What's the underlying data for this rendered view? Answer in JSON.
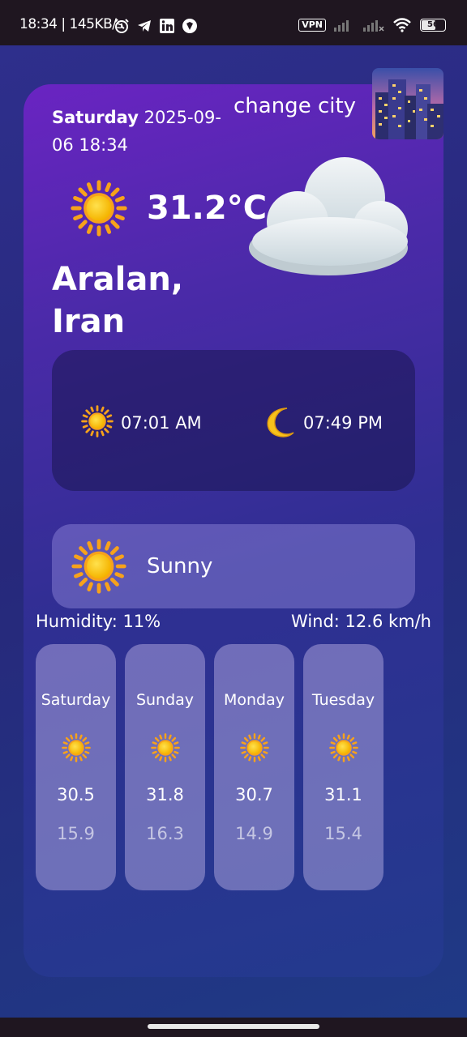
{
  "status_bar": {
    "time_speed": "18:34 | 145KB/s",
    "vpn_label": "VPN",
    "battery_level": "56",
    "icons": [
      "alarm-icon",
      "telegram-icon",
      "linkedin-icon",
      "app-icon",
      "signal-icon",
      "wifi-icon",
      "battery-icon"
    ]
  },
  "header": {
    "day": "Saturday",
    "date_time": "2025-09-06 18:34",
    "change_city_label": "change city"
  },
  "current": {
    "temperature": "31.2°C",
    "location_line1": "Aralan,",
    "location_line2": "Iran",
    "condition": "Sunny",
    "icon": "sun-icon",
    "decor_icon": "cloud-icon"
  },
  "sun_times": {
    "sunrise": "07:01 AM",
    "sunset": "07:49 PM"
  },
  "details": {
    "humidity": "Humidity: 11%",
    "wind": "Wind: 12.6 km/h"
  },
  "forecast": [
    {
      "day": "Saturday",
      "high": "30.5",
      "low": "15.9",
      "icon": "sun-icon"
    },
    {
      "day": "Sunday",
      "high": "31.8",
      "low": "16.3",
      "icon": "sun-icon"
    },
    {
      "day": "Monday",
      "high": "30.7",
      "low": "14.9",
      "icon": "sun-icon"
    },
    {
      "day": "Tuesday",
      "high": "31.1",
      "low": "15.4",
      "icon": "sun-icon"
    }
  ],
  "colors": {
    "card_gradient_start": "#6a24c2",
    "card_gradient_end": "#233a8e",
    "sun": "#fcc419"
  }
}
